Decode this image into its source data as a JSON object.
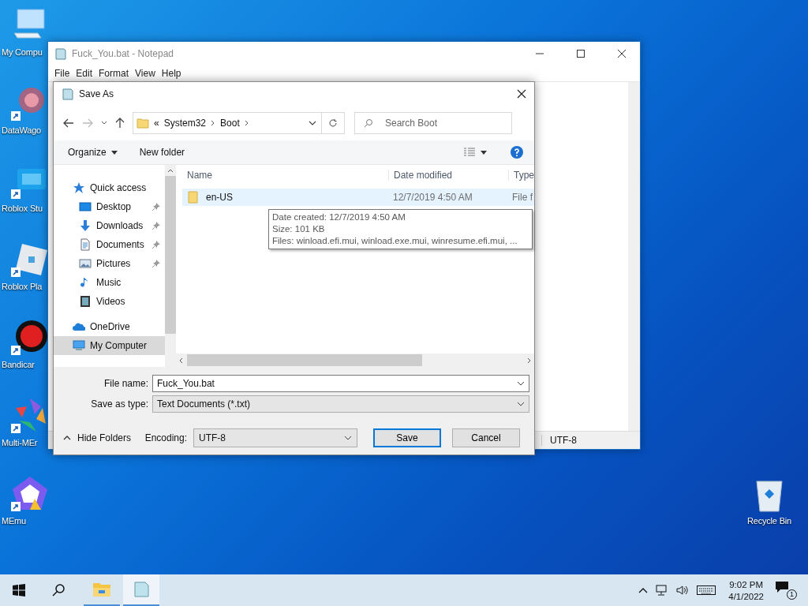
{
  "desktop": {
    "icons": [
      {
        "label": "My Compu",
        "kind": "computer"
      },
      {
        "label": "DataWago",
        "kind": "pattern"
      },
      {
        "label": "Roblox Stu",
        "kind": "studio"
      },
      {
        "label": "Roblox Pla",
        "kind": "player"
      },
      {
        "label": "Bandicar",
        "kind": "record"
      },
      {
        "label": "Multi-MEr",
        "kind": "aperture"
      },
      {
        "label": "MEmu",
        "kind": "pentagon"
      }
    ],
    "recycle_bin": {
      "label": "Recycle Bin"
    }
  },
  "notepad": {
    "title": "Fuck_You.bat - Notepad",
    "menu": [
      "File",
      "Edit",
      "Format",
      "View",
      "Help"
    ],
    "status_encoding": "UTF-8"
  },
  "dialog": {
    "title": "Save As",
    "address": {
      "overflow": "«",
      "crumbs": [
        "System32",
        "Boot"
      ]
    },
    "search": {
      "placeholder": "Search Boot"
    },
    "toolbar": [
      "Organize",
      "New folder"
    ],
    "nav_pane": [
      {
        "label": "Quick access",
        "kind": "star",
        "selected": false,
        "children": [
          {
            "label": "Desktop",
            "kind": "desktop",
            "pinned": true,
            "selected": false
          },
          {
            "label": "Downloads",
            "kind": "download",
            "pinned": true,
            "selected": false
          },
          {
            "label": "Documents",
            "kind": "document",
            "pinned": true,
            "selected": false
          },
          {
            "label": "Pictures",
            "kind": "picture",
            "pinned": true,
            "selected": false
          },
          {
            "label": "Music",
            "kind": "music",
            "pinned": false,
            "selected": false
          },
          {
            "label": "Videos",
            "kind": "video",
            "pinned": false,
            "selected": false
          }
        ]
      },
      {
        "label": "OneDrive",
        "kind": "cloud",
        "selected": false
      },
      {
        "label": "My Computer",
        "kind": "computer",
        "selected": true
      }
    ],
    "columns": [
      "Name",
      "Date modified",
      "Type"
    ],
    "rows": [
      {
        "name": "en-US",
        "date_modified": "12/7/2019 4:50 AM",
        "type": "File f",
        "selected": true
      }
    ],
    "tooltip": [
      "Date created: 12/7/2019 4:50 AM",
      "Size: 101 KB",
      "Files: winload.efi.mui, winload.exe.mui, winresume.efi.mui, ..."
    ],
    "file_name": {
      "label": "File name:",
      "value": "Fuck_You.bat"
    },
    "save_as_type": {
      "label": "Save as type:",
      "value": "Text Documents (*.txt)"
    },
    "hide_folders": "Hide Folders",
    "encoding": {
      "label": "Encoding:",
      "value": "UTF-8"
    },
    "buttons": [
      {
        "label": "Save",
        "default": true
      },
      {
        "label": "Cancel",
        "default": false
      }
    ]
  },
  "taskbar": {
    "apps": [
      {
        "kind": "folder",
        "selected": false
      },
      {
        "kind": "notepad",
        "selected": true
      }
    ],
    "time": "9:02 PM",
    "date": "4/1/2022",
    "notifications": "1"
  }
}
